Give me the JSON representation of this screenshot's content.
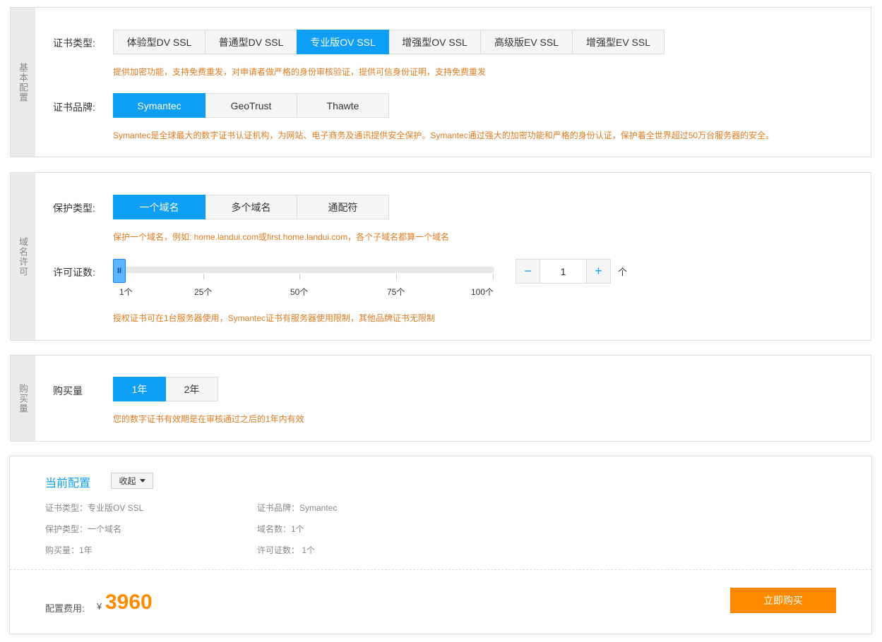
{
  "basic": {
    "side_label": "基本配置",
    "cert_type_label": "证书类型:",
    "cert_types": [
      "体验型DV SSL",
      "普通型DV SSL",
      "专业版OV SSL",
      "增强型OV SSL",
      "高级版EV SSL",
      "增强型EV SSL"
    ],
    "cert_type_selected": "专业版OV SSL",
    "cert_type_hint": "提供加密功能，支持免费重发，对申请者做严格的身份审核验证，提供可信身份证明，支持免费重发",
    "brand_label": "证书品牌:",
    "brands": [
      "Symantec",
      "GeoTrust",
      "Thawte"
    ],
    "brand_selected": "Symantec",
    "brand_hint": "Symantec是全球最大的数字证书认证机构，为网站、电子商务及通讯提供安全保护。Symantec通过强大的加密功能和严格的身份认证，保护着全世界超过50万台服务器的安全。"
  },
  "domain": {
    "side_label": "域名许可",
    "protect_label": "保护类型:",
    "protect_types": [
      "一个域名",
      "多个域名",
      "通配符"
    ],
    "protect_selected": "一个域名",
    "protect_hint": "保护一个域名，例如: home.landui.com或first.home.landui.com，各个子域名都算一个域名",
    "license_label": "许可证数:",
    "slider_ticks": [
      "1个",
      "25个",
      "50个",
      "75个",
      "100个"
    ],
    "slider_value": 1,
    "slider_handle_glyph": "II",
    "stepper_minus": "−",
    "stepper_plus": "+",
    "stepper_value": "1",
    "unit": "个",
    "license_hint": "授权证书可在1台服务器使用，Symantec证书有服务器使用限制，其他品牌证书无限制"
  },
  "purchase": {
    "side_label": "购买量",
    "label": "购买量",
    "periods": [
      "1年",
      "2年"
    ],
    "period_selected": "1年",
    "hint": "您的数字证书有效期是在审核通过之后的1年内有效"
  },
  "summary": {
    "title": "当前配置",
    "collapse_label": "收起",
    "items": {
      "cert_type": "证书类型：专业版OV SSL",
      "brand": "证书品牌：Symantec",
      "protect": "保护类型：一个域名",
      "domains": "域名数：1个",
      "purchase": "购买量：1年",
      "licenses": "许可证数： 1个"
    },
    "price_label": "配置费用:",
    "currency": "¥",
    "price": "3960",
    "buy_label": "立即购买"
  },
  "colors": {
    "accent": "#0f9ef5",
    "hint": "#e27b1f",
    "price": "#ff8a00"
  }
}
